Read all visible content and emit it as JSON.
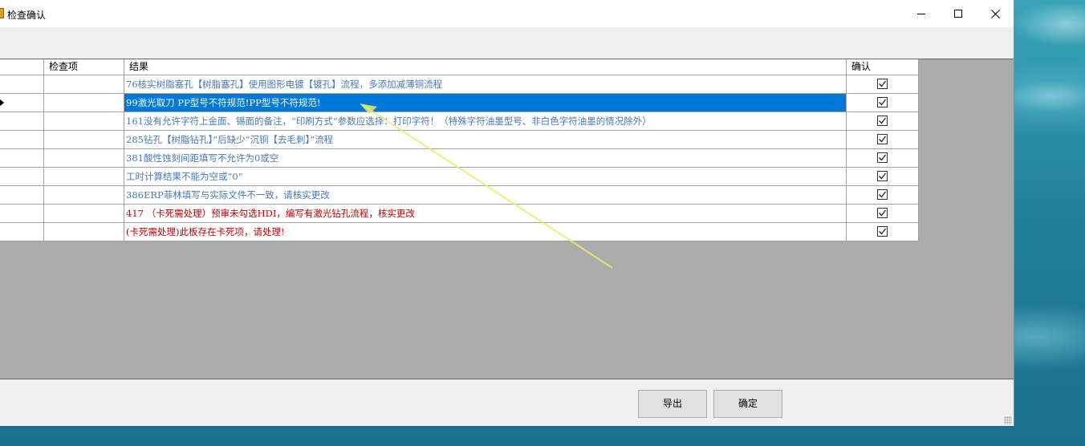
{
  "window": {
    "title": "检查确认",
    "controls": {
      "minimize": "minimize-icon",
      "maximize": "maximize-icon",
      "close": "close-icon"
    }
  },
  "grid": {
    "columns": {
      "item": "检查项",
      "result": "结果",
      "confirm": "确认"
    },
    "rows": [
      {
        "result": "76核实树脂塞孔【树脂塞孔】使用图形电镀【镀孔】流程，多添加减薄铜流程",
        "confirmed": true
      },
      {
        "result": "99激光取刀 PP型号不符规范!PP型号不符规范!",
        "confirmed": true
      },
      {
        "result": "161没有允许字符上金面、锡面的备注，“印刷方式”参数应选择：打印字符！（特殊字符油墨型号、非白色字符油墨的情况除外）",
        "confirmed": true
      },
      {
        "result": "285钻孔【树脂钻孔】”后缺少“沉铜【去毛刺】”流程",
        "confirmed": true
      },
      {
        "result": "381酸性蚀刻间距填写不允许为0或空",
        "confirmed": true
      },
      {
        "result": "工时计算结果不能为空或“0”",
        "confirmed": true
      },
      {
        "result": "386ERP菲林填写与实际文件不一致，请核实更改",
        "confirmed": true
      },
      {
        "result": "417 （卡死需处理）预审未勾选HDI，编写有激光钻孔流程，核实更改",
        "confirmed": true
      },
      {
        "result": "(卡死需处理)此板存在卡死项，请处理!",
        "confirmed": true
      }
    ]
  },
  "footer": {
    "export_label": "导出",
    "ok_label": "确定"
  },
  "colors": {
    "selected": "#0078d7",
    "blue_text": "#4a78b8",
    "red_text": "#c00000",
    "annotation": "#e8ec6a"
  }
}
